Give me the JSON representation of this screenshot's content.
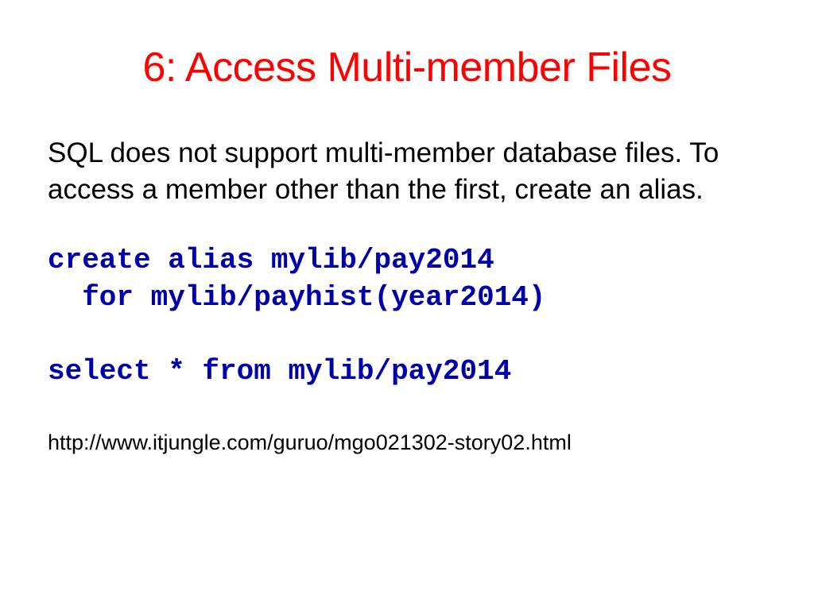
{
  "slide": {
    "title": "6: Access Multi-member Files",
    "body": "SQL does not support multi-member database files. To access a member other than the first, create an alias.",
    "code": "create alias mylib/pay2014\n  for mylib/payhist(year2014)\n\nselect * from mylib/pay2014",
    "footer_url": "http://www.itjungle.com/guruo/mgo021302-story02.html"
  }
}
